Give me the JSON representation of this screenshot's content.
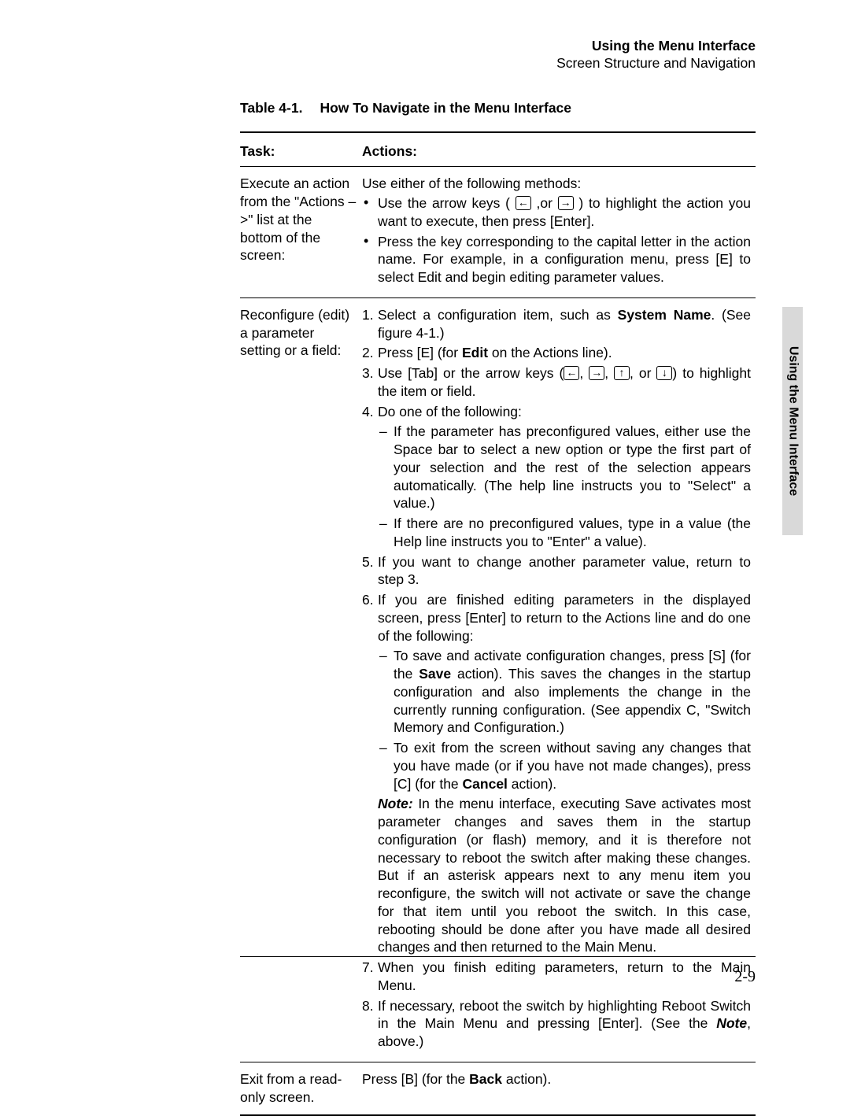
{
  "header": {
    "line1": "Using the Menu Interface",
    "line2": "Screen Structure and Navigation"
  },
  "side_tab": "Using the Menu Interface",
  "page_number": "2-9",
  "table": {
    "caption_number": "Table 4-1.",
    "caption_title": "How To Navigate in the Menu Interface",
    "headers": {
      "task": "Task:",
      "actions": "Actions:"
    },
    "rows": {
      "execute": {
        "task": "Execute an action from the \"Actions –>\" list at the bottom of the screen:",
        "intro": "Use either of the following methods:",
        "bullet1a": "Use the arrow keys ( ",
        "bullet1b": " ,or ",
        "bullet1c": " ) to highlight the action you want to execute, then press [Enter].",
        "bullet2": "Press the key corresponding to the capital letter in the action name. For example, in a configuration menu, press [E] to select Edit and begin editing parameter values."
      },
      "reconfig": {
        "task": "Reconfigure (edit) a parameter setting or a field:",
        "step1a": "Select a configuration item, such as ",
        "step1b_bold": "System Name",
        "step1c": ". (See figure 4-1.)",
        "step2a": "Press [E] (for ",
        "step2b_bold": "Edit",
        "step2c": " on the Actions line).",
        "step3a": "Use [Tab] or the arrow keys (",
        "step3b": ", ",
        "step3c": ", ",
        "step3d": ", or ",
        "step3e": ") to highlight the item or field.",
        "step4": "Do one of the following:",
        "step4_dash1": "If the parameter has preconfigured values, either use the Space bar to select a new option or type the first part of your selection and the rest of the selection appears automatically. (The help line instructs you to \"Select\" a value.)",
        "step4_dash2": "If there are no preconfigured values, type in a value (the Help line instructs you to \"Enter\" a value).",
        "step5": "If you want to change another parameter value, return to step 3.",
        "step6": "If you are finished editing parameters in the displayed screen, press [Enter] to return to the Actions line and do one of the following:",
        "step6_dash1a": "To save and activate configuration changes, press [S] (for the ",
        "step6_dash1b_bold": "Save",
        "step6_dash1c": " action). This saves the changes in the startup configuration and also implements the change in the currently running configuration. (See appendix C, \"Switch Memory and Configuration.)",
        "step6_dash2a": "To exit from the screen without saving any changes that you have made (or if you have not made changes), press [C] (for the ",
        "step6_dash2b_bold": "Cancel",
        "step6_dash2c": " action).",
        "note_label": "Note:",
        "note_body": "  In the menu interface, executing Save activates most parameter changes and saves them in the startup configuration (or flash) memory, and it is therefore not necessary to reboot the switch after making these changes. But if an asterisk appears next to any menu item you reconfigure, the switch will not activate or save the change for that item until you reboot the switch. In this case, rebooting should be done after you have made all desired changes and then returned to the Main Menu.",
        "step7": "When you finish editing parameters, return to the Main Menu.",
        "step8a": "If necessary, reboot the switch by highlighting Reboot Switch in the Main Menu and pressing [Enter]. (See the ",
        "step8b_bolditalic": "Note",
        "step8c": ", above.)"
      },
      "exit": {
        "task": "Exit from a read-only screen.",
        "action_a": "Press [B] (for the ",
        "action_b_bold": "Back",
        "action_c": " action)."
      }
    }
  },
  "arrows": {
    "left": "←",
    "right": "→",
    "up": "↑",
    "down": "↓"
  }
}
